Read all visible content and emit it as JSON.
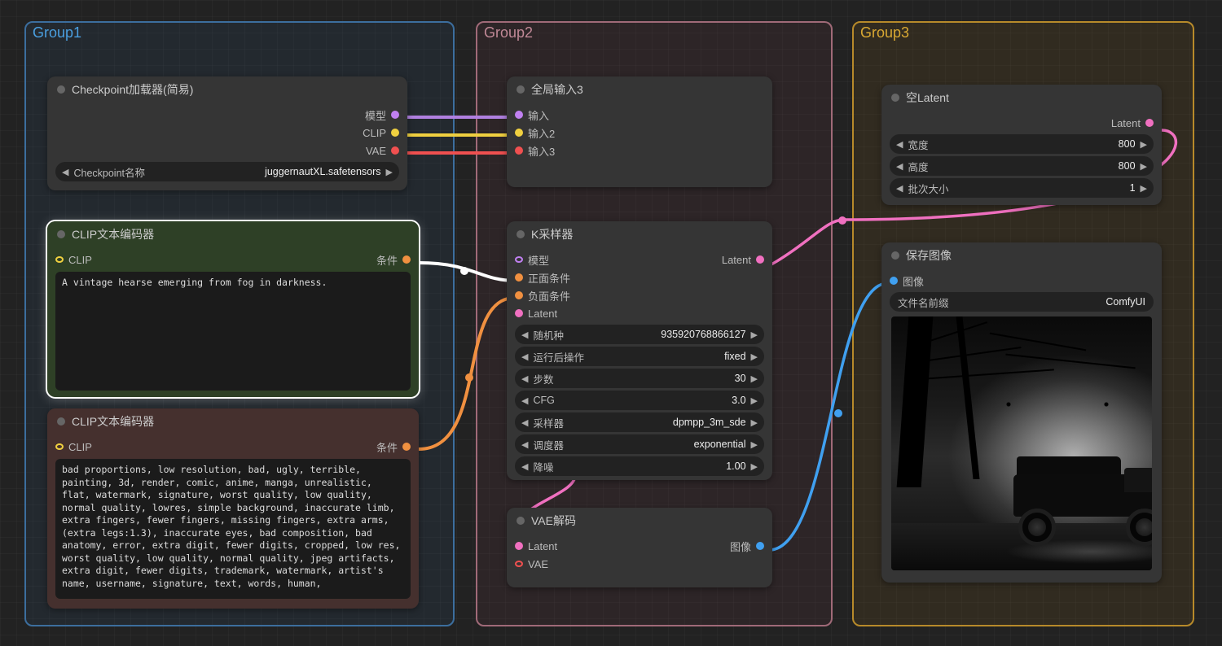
{
  "groups": {
    "g1": {
      "title": "Group1"
    },
    "g2": {
      "title": "Group2"
    },
    "g3": {
      "title": "Group3"
    }
  },
  "nodes": {
    "checkpoint": {
      "title": "Checkpoint加载器(简易)",
      "out_model": "模型",
      "out_clip": "CLIP",
      "out_vae": "VAE",
      "widget_label": "Checkpoint名称",
      "widget_value": "juggernautXL.safetensors"
    },
    "clip_pos": {
      "title": "CLIP文本编码器",
      "in_clip": "CLIP",
      "out_cond": "条件",
      "text": "A vintage hearse emerging from fog in darkness."
    },
    "clip_neg": {
      "title": "CLIP文本编码器",
      "in_clip": "CLIP",
      "out_cond": "条件",
      "text": "bad proportions, low resolution, bad, ugly, terrible, painting, 3d, render, comic, anime, manga, unrealistic, flat, watermark, signature, worst quality, low quality, normal quality, lowres, simple background, inaccurate limb, extra fingers, fewer fingers, missing fingers, extra arms, (extra legs:1.3), inaccurate eyes, bad composition, bad anatomy, error, extra digit, fewer digits, cropped, low res, worst quality, low quality, normal quality, jpeg artifacts, extra digit, fewer digits, trademark, watermark, artist's name, username, signature, text, words, human,"
    },
    "global_in": {
      "title": "全局输入3",
      "in1": "输入",
      "in2": "输入2",
      "in3": "输入3"
    },
    "ksampler": {
      "title": "K采样器",
      "in_model": "模型",
      "in_pos": "正面条件",
      "in_neg": "负面条件",
      "in_latent": "Latent",
      "out_latent": "Latent",
      "w_seed_label": "随机种",
      "w_seed_value": "935920768866127",
      "w_after_label": "运行后操作",
      "w_after_value": "fixed",
      "w_steps_label": "步数",
      "w_steps_value": "30",
      "w_cfg_label": "CFG",
      "w_cfg_value": "3.0",
      "w_sampler_label": "采样器",
      "w_sampler_value": "dpmpp_3m_sde",
      "w_scheduler_label": "调度器",
      "w_scheduler_value": "exponential",
      "w_denoise_label": "降噪",
      "w_denoise_value": "1.00"
    },
    "vae_decode": {
      "title": "VAE解码",
      "in_latent": "Latent",
      "in_vae": "VAE",
      "out_image": "图像"
    },
    "empty_latent": {
      "title": "空Latent",
      "out_latent": "Latent",
      "w_width_label": "宽度",
      "w_width_value": "800",
      "w_height_label": "高度",
      "w_height_value": "800",
      "w_batch_label": "批次大小",
      "w_batch_value": "1"
    },
    "save_image": {
      "title": "保存图像",
      "in_image": "图像",
      "w_prefix_label": "文件名前缀",
      "w_prefix_value": "ComfyUI"
    }
  }
}
